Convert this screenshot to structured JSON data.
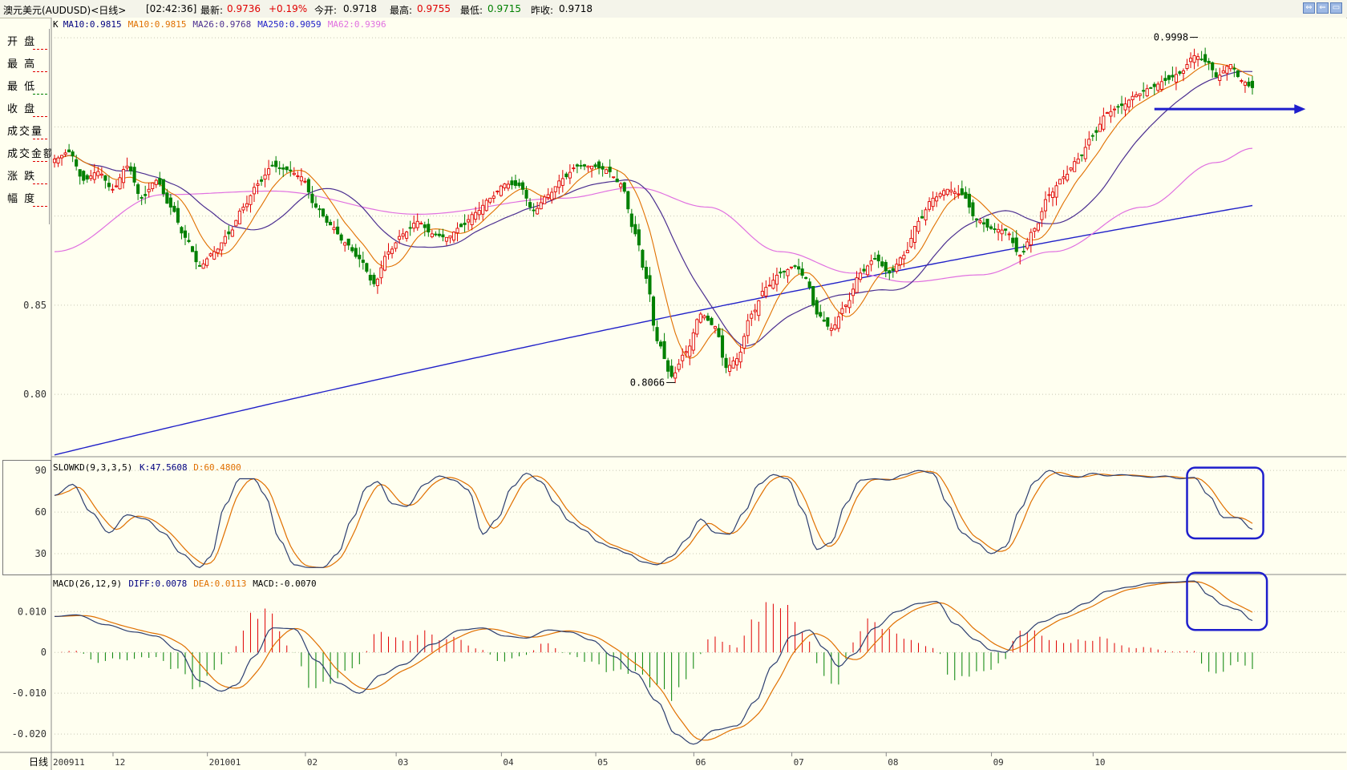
{
  "title": {
    "symbol": "澳元美元(AUDUSD)<日线>",
    "time": "[02:42:36]",
    "latest_label": "最新:",
    "latest": "0.9736",
    "change": "+0.19%",
    "open_label": "今开:",
    "open": "0.9718",
    "high_label": "最高:",
    "high": "0.9755",
    "low_label": "最低:",
    "low": "0.9715",
    "prev_label": "昨收:",
    "prev": "0.9718"
  },
  "window_buttons": [
    "restore-icon",
    "minimize-icon",
    "close-icon"
  ],
  "side_panel": [
    {
      "label": "开 盘",
      "dash": "red"
    },
    {
      "label": "最 高",
      "dash": "red"
    },
    {
      "label": "最 低",
      "dash": "green"
    },
    {
      "label": "收 盘",
      "dash": "red"
    },
    {
      "label": "成交量",
      "dash": "red"
    },
    {
      "label": "成交金额",
      "dash": "red"
    },
    {
      "label": "涨 跌",
      "dash": "red"
    },
    {
      "label": "幅 度",
      "dash": "red"
    }
  ],
  "legends": {
    "main": [
      {
        "text": "K",
        "color": "#000000"
      },
      {
        "text": "MA10:0.9815",
        "color": "#000080"
      },
      {
        "text": "MA10:0.9815",
        "color": "#E07000"
      },
      {
        "text": "MA26:0.9768",
        "color": "#4B2E90"
      },
      {
        "text": "MA250:0.9059",
        "color": "#2020C8"
      },
      {
        "text": "MA62:0.9396",
        "color": "#E070E0"
      }
    ],
    "kd": [
      {
        "text": "SLOWKD(9,3,3,5)",
        "color": "#000000"
      },
      {
        "text": "K:47.5608",
        "color": "#000080"
      },
      {
        "text": "D:60.4800",
        "color": "#E07000"
      }
    ],
    "macd": [
      {
        "text": "MACD(26,12,9)",
        "color": "#000000"
      },
      {
        "text": "DIFF:0.0078",
        "color": "#000080"
      },
      {
        "text": "DEA:0.0113",
        "color": "#E07000"
      },
      {
        "text": "MACD:-0.0070",
        "color": "#000000"
      }
    ]
  },
  "colors": {
    "up": "#E00000",
    "down": "#008000",
    "ma10": "#E07000",
    "ma26": "#4B2E90",
    "ma250": "#2020C8",
    "ma62": "#E070E0",
    "kline": "#2C3E70",
    "dline": "#E07000",
    "hist_up": "#E00000",
    "hist_down": "#008000",
    "grid": "#C8C8B4",
    "highlight": "#1E1ECC"
  },
  "chart_data": [
    {
      "type": "candlestick",
      "name": "price",
      "y_ticks": [
        {
          "value": 0.85,
          "label": "0.85"
        },
        {
          "value": 0.8,
          "label": "0.80"
        }
      ],
      "ylim": [
        0.765,
        1.005
      ],
      "annotations": [
        {
          "label": "0.9998",
          "index": 315,
          "value": 0.9998
        },
        {
          "label": "0.8066",
          "index": 171,
          "value": 0.8066
        }
      ],
      "arrow": {
        "from_index": 303,
        "to_index": 342,
        "value": 0.96,
        "direction": "right"
      },
      "anchors": [
        {
          "i": 0,
          "v": 0.932
        },
        {
          "i": 4,
          "v": 0.936
        },
        {
          "i": 8,
          "v": 0.92
        },
        {
          "i": 12,
          "v": 0.925
        },
        {
          "i": 16,
          "v": 0.915
        },
        {
          "i": 20,
          "v": 0.928
        },
        {
          "i": 24,
          "v": 0.91
        },
        {
          "i": 28,
          "v": 0.92
        },
        {
          "i": 32,
          "v": 0.905
        },
        {
          "i": 36,
          "v": 0.888
        },
        {
          "i": 40,
          "v": 0.872
        },
        {
          "i": 44,
          "v": 0.88
        },
        {
          "i": 48,
          "v": 0.89
        },
        {
          "i": 52,
          "v": 0.905
        },
        {
          "i": 56,
          "v": 0.918
        },
        {
          "i": 60,
          "v": 0.928
        },
        {
          "i": 64,
          "v": 0.926
        },
        {
          "i": 68,
          "v": 0.922
        },
        {
          "i": 72,
          "v": 0.905
        },
        {
          "i": 76,
          "v": 0.895
        },
        {
          "i": 80,
          "v": 0.885
        },
        {
          "i": 84,
          "v": 0.876
        },
        {
          "i": 88,
          "v": 0.862
        },
        {
          "i": 92,
          "v": 0.88
        },
        {
          "i": 96,
          "v": 0.89
        },
        {
          "i": 100,
          "v": 0.897
        },
        {
          "i": 104,
          "v": 0.89
        },
        {
          "i": 108,
          "v": 0.888
        },
        {
          "i": 112,
          "v": 0.894
        },
        {
          "i": 116,
          "v": 0.902
        },
        {
          "i": 120,
          "v": 0.91
        },
        {
          "i": 124,
          "v": 0.918
        },
        {
          "i": 128,
          "v": 0.917
        },
        {
          "i": 132,
          "v": 0.903
        },
        {
          "i": 136,
          "v": 0.912
        },
        {
          "i": 140,
          "v": 0.921
        },
        {
          "i": 144,
          "v": 0.928
        },
        {
          "i": 148,
          "v": 0.928
        },
        {
          "i": 152,
          "v": 0.926
        },
        {
          "i": 156,
          "v": 0.918
        },
        {
          "i": 160,
          "v": 0.89
        },
        {
          "i": 163,
          "v": 0.865
        },
        {
          "i": 166,
          "v": 0.83
        },
        {
          "i": 170,
          "v": 0.81
        },
        {
          "i": 174,
          "v": 0.824
        },
        {
          "i": 178,
          "v": 0.845
        },
        {
          "i": 182,
          "v": 0.838
        },
        {
          "i": 185,
          "v": 0.815
        },
        {
          "i": 188,
          "v": 0.82
        },
        {
          "i": 192,
          "v": 0.845
        },
        {
          "i": 196,
          "v": 0.86
        },
        {
          "i": 200,
          "v": 0.868
        },
        {
          "i": 204,
          "v": 0.872
        },
        {
          "i": 207,
          "v": 0.865
        },
        {
          "i": 210,
          "v": 0.845
        },
        {
          "i": 214,
          "v": 0.837
        },
        {
          "i": 218,
          "v": 0.85
        },
        {
          "i": 222,
          "v": 0.868
        },
        {
          "i": 226,
          "v": 0.876
        },
        {
          "i": 230,
          "v": 0.868
        },
        {
          "i": 234,
          "v": 0.878
        },
        {
          "i": 238,
          "v": 0.897
        },
        {
          "i": 242,
          "v": 0.91
        },
        {
          "i": 246,
          "v": 0.915
        },
        {
          "i": 250,
          "v": 0.912
        },
        {
          "i": 254,
          "v": 0.898
        },
        {
          "i": 258,
          "v": 0.893
        },
        {
          "i": 262,
          "v": 0.892
        },
        {
          "i": 266,
          "v": 0.878
        },
        {
          "i": 270,
          "v": 0.893
        },
        {
          "i": 274,
          "v": 0.912
        },
        {
          "i": 278,
          "v": 0.922
        },
        {
          "i": 282,
          "v": 0.932
        },
        {
          "i": 286,
          "v": 0.945
        },
        {
          "i": 290,
          "v": 0.958
        },
        {
          "i": 294,
          "v": 0.962
        },
        {
          "i": 298,
          "v": 0.968
        },
        {
          "i": 302,
          "v": 0.972
        },
        {
          "i": 306,
          "v": 0.976
        },
        {
          "i": 310,
          "v": 0.98
        },
        {
          "i": 314,
          "v": 0.99
        },
        {
          "i": 318,
          "v": 0.986
        },
        {
          "i": 320,
          "v": 0.978
        },
        {
          "i": 324,
          "v": 0.985
        },
        {
          "i": 327,
          "v": 0.976
        },
        {
          "i": 330,
          "v": 0.972
        }
      ],
      "ma250": {
        "start": 0.766,
        "end": 0.9059,
        "curve": 0.55
      },
      "ma62_anchors": [
        {
          "i": 0,
          "v": 0.88
        },
        {
          "i": 30,
          "v": 0.912
        },
        {
          "i": 60,
          "v": 0.914
        },
        {
          "i": 100,
          "v": 0.901
        },
        {
          "i": 140,
          "v": 0.91
        },
        {
          "i": 160,
          "v": 0.916
        },
        {
          "i": 180,
          "v": 0.905
        },
        {
          "i": 200,
          "v": 0.88
        },
        {
          "i": 220,
          "v": 0.868
        },
        {
          "i": 235,
          "v": 0.863
        },
        {
          "i": 255,
          "v": 0.867
        },
        {
          "i": 275,
          "v": 0.88
        },
        {
          "i": 300,
          "v": 0.905
        },
        {
          "i": 320,
          "v": 0.93
        },
        {
          "i": 330,
          "v": 0.938
        }
      ],
      "x_ticks": [
        {
          "index": 0,
          "label": "200911"
        },
        {
          "index": 17,
          "label": "12"
        },
        {
          "index": 43,
          "label": "201001"
        },
        {
          "index": 70,
          "label": "02"
        },
        {
          "index": 95,
          "label": "03"
        },
        {
          "index": 124,
          "label": "04"
        },
        {
          "index": 150,
          "label": "05"
        },
        {
          "index": 177,
          "label": "06"
        },
        {
          "index": 204,
          "label": "07"
        },
        {
          "index": 230,
          "label": "08"
        },
        {
          "index": 259,
          "label": "09"
        },
        {
          "index": 287,
          "label": "10"
        }
      ],
      "x_axis_label": "日线",
      "count": 331
    },
    {
      "type": "line",
      "name": "slowkd",
      "y_ticks": [
        {
          "value": 90,
          "label": "90"
        },
        {
          "value": 60,
          "label": "60"
        },
        {
          "value": 30,
          "label": "30"
        }
      ],
      "ylim": [
        15,
        97
      ],
      "k_anchors": [
        {
          "i": 0,
          "v": 72
        },
        {
          "i": 5,
          "v": 80
        },
        {
          "i": 10,
          "v": 60
        },
        {
          "i": 15,
          "v": 45
        },
        {
          "i": 20,
          "v": 58
        },
        {
          "i": 25,
          "v": 55
        },
        {
          "i": 30,
          "v": 45
        },
        {
          "i": 35,
          "v": 30
        },
        {
          "i": 40,
          "v": 20
        },
        {
          "i": 43,
          "v": 28
        },
        {
          "i": 47,
          "v": 65
        },
        {
          "i": 51,
          "v": 84
        },
        {
          "i": 55,
          "v": 84
        },
        {
          "i": 58,
          "v": 72
        },
        {
          "i": 62,
          "v": 40
        },
        {
          "i": 66,
          "v": 22
        },
        {
          "i": 70,
          "v": 20
        },
        {
          "i": 74,
          "v": 20
        },
        {
          "i": 78,
          "v": 30
        },
        {
          "i": 82,
          "v": 55
        },
        {
          "i": 86,
          "v": 78
        },
        {
          "i": 89,
          "v": 82
        },
        {
          "i": 93,
          "v": 66
        },
        {
          "i": 97,
          "v": 64
        },
        {
          "i": 102,
          "v": 80
        },
        {
          "i": 106,
          "v": 86
        },
        {
          "i": 110,
          "v": 83
        },
        {
          "i": 114,
          "v": 76
        },
        {
          "i": 118,
          "v": 44
        },
        {
          "i": 122,
          "v": 55
        },
        {
          "i": 126,
          "v": 78
        },
        {
          "i": 130,
          "v": 88
        },
        {
          "i": 134,
          "v": 82
        },
        {
          "i": 138,
          "v": 66
        },
        {
          "i": 142,
          "v": 53
        },
        {
          "i": 146,
          "v": 47
        },
        {
          "i": 150,
          "v": 38
        },
        {
          "i": 154,
          "v": 34
        },
        {
          "i": 158,
          "v": 30
        },
        {
          "i": 162,
          "v": 24
        },
        {
          "i": 166,
          "v": 22
        },
        {
          "i": 170,
          "v": 28
        },
        {
          "i": 174,
          "v": 40
        },
        {
          "i": 178,
          "v": 55
        },
        {
          "i": 182,
          "v": 45
        },
        {
          "i": 186,
          "v": 44
        },
        {
          "i": 190,
          "v": 60
        },
        {
          "i": 194,
          "v": 80
        },
        {
          "i": 198,
          "v": 87
        },
        {
          "i": 202,
          "v": 84
        },
        {
          "i": 206,
          "v": 62
        },
        {
          "i": 210,
          "v": 33
        },
        {
          "i": 214,
          "v": 38
        },
        {
          "i": 218,
          "v": 66
        },
        {
          "i": 222,
          "v": 83
        },
        {
          "i": 226,
          "v": 84
        },
        {
          "i": 230,
          "v": 83
        },
        {
          "i": 234,
          "v": 87
        },
        {
          "i": 238,
          "v": 90
        },
        {
          "i": 242,
          "v": 88
        },
        {
          "i": 246,
          "v": 66
        },
        {
          "i": 250,
          "v": 45
        },
        {
          "i": 254,
          "v": 38
        },
        {
          "i": 258,
          "v": 30
        },
        {
          "i": 262,
          "v": 35
        },
        {
          "i": 266,
          "v": 62
        },
        {
          "i": 270,
          "v": 82
        },
        {
          "i": 274,
          "v": 90
        },
        {
          "i": 278,
          "v": 86
        },
        {
          "i": 282,
          "v": 85
        },
        {
          "i": 286,
          "v": 88
        },
        {
          "i": 290,
          "v": 86
        },
        {
          "i": 294,
          "v": 87
        },
        {
          "i": 298,
          "v": 86
        },
        {
          "i": 302,
          "v": 85
        },
        {
          "i": 306,
          "v": 86
        },
        {
          "i": 310,
          "v": 84
        },
        {
          "i": 314,
          "v": 85
        },
        {
          "i": 318,
          "v": 72
        },
        {
          "i": 322,
          "v": 56
        },
        {
          "i": 326,
          "v": 56
        },
        {
          "i": 330,
          "v": 47.5608
        }
      ],
      "d_lag": 4,
      "highlight_box": {
        "from_index": 312,
        "to_index": 333,
        "top": 92,
        "bottom": 41
      }
    },
    {
      "type": "bar+line",
      "name": "macd",
      "y_ticks": [
        {
          "value": 0.01,
          "label": "0.010"
        },
        {
          "value": 0,
          "label": "0"
        },
        {
          "value": -0.01,
          "label": "-0.010"
        },
        {
          "value": -0.02,
          "label": "-0.020"
        }
      ],
      "ylim": [
        -0.0245,
        0.0185
      ],
      "diff_anchors": [
        {
          "i": 0,
          "v": 0.0088
        },
        {
          "i": 6,
          "v": 0.0092
        },
        {
          "i": 14,
          "v": 0.0068
        },
        {
          "i": 22,
          "v": 0.005
        },
        {
          "i": 28,
          "v": 0.004
        },
        {
          "i": 34,
          "v": 0.0005
        },
        {
          "i": 40,
          "v": -0.007
        },
        {
          "i": 46,
          "v": -0.0095
        },
        {
          "i": 50,
          "v": -0.008
        },
        {
          "i": 55,
          "v": -0.001
        },
        {
          "i": 60,
          "v": 0.006
        },
        {
          "i": 66,
          "v": 0.0058
        },
        {
          "i": 72,
          "v": -0.002
        },
        {
          "i": 78,
          "v": -0.0075
        },
        {
          "i": 84,
          "v": -0.01
        },
        {
          "i": 90,
          "v": -0.0055
        },
        {
          "i": 96,
          "v": -0.003
        },
        {
          "i": 104,
          "v": 0.002
        },
        {
          "i": 112,
          "v": 0.0055
        },
        {
          "i": 118,
          "v": 0.006
        },
        {
          "i": 124,
          "v": 0.004
        },
        {
          "i": 130,
          "v": 0.0035
        },
        {
          "i": 136,
          "v": 0.0055
        },
        {
          "i": 142,
          "v": 0.005
        },
        {
          "i": 148,
          "v": 0.003
        },
        {
          "i": 154,
          "v": -0.001
        },
        {
          "i": 160,
          "v": -0.005
        },
        {
          "i": 166,
          "v": -0.012
        },
        {
          "i": 171,
          "v": -0.02
        },
        {
          "i": 176,
          "v": -0.0225
        },
        {
          "i": 182,
          "v": -0.019
        },
        {
          "i": 188,
          "v": -0.018
        },
        {
          "i": 193,
          "v": -0.012
        },
        {
          "i": 198,
          "v": -0.003
        },
        {
          "i": 203,
          "v": 0.004
        },
        {
          "i": 208,
          "v": 0.0055
        },
        {
          "i": 212,
          "v": 0.001
        },
        {
          "i": 216,
          "v": -0.0035
        },
        {
          "i": 220,
          "v": -0.0005
        },
        {
          "i": 226,
          "v": 0.006
        },
        {
          "i": 232,
          "v": 0.01
        },
        {
          "i": 238,
          "v": 0.012
        },
        {
          "i": 243,
          "v": 0.0125
        },
        {
          "i": 248,
          "v": 0.007
        },
        {
          "i": 254,
          "v": 0.003
        },
        {
          "i": 258,
          "v": 0.0005
        },
        {
          "i": 262,
          "v": 0.0
        },
        {
          "i": 266,
          "v": 0.004
        },
        {
          "i": 272,
          "v": 0.0075
        },
        {
          "i": 278,
          "v": 0.0095
        },
        {
          "i": 284,
          "v": 0.012
        },
        {
          "i": 290,
          "v": 0.015
        },
        {
          "i": 296,
          "v": 0.016
        },
        {
          "i": 302,
          "v": 0.017
        },
        {
          "i": 308,
          "v": 0.0172
        },
        {
          "i": 314,
          "v": 0.0175
        },
        {
          "i": 318,
          "v": 0.014
        },
        {
          "i": 322,
          "v": 0.0115
        },
        {
          "i": 326,
          "v": 0.0105
        },
        {
          "i": 330,
          "v": 0.0078
        }
      ],
      "dea_lag": 7,
      "highlight_box": {
        "from_index": 312,
        "to_index": 334,
        "top": 0.0195,
        "bottom": 0.0055
      }
    }
  ]
}
